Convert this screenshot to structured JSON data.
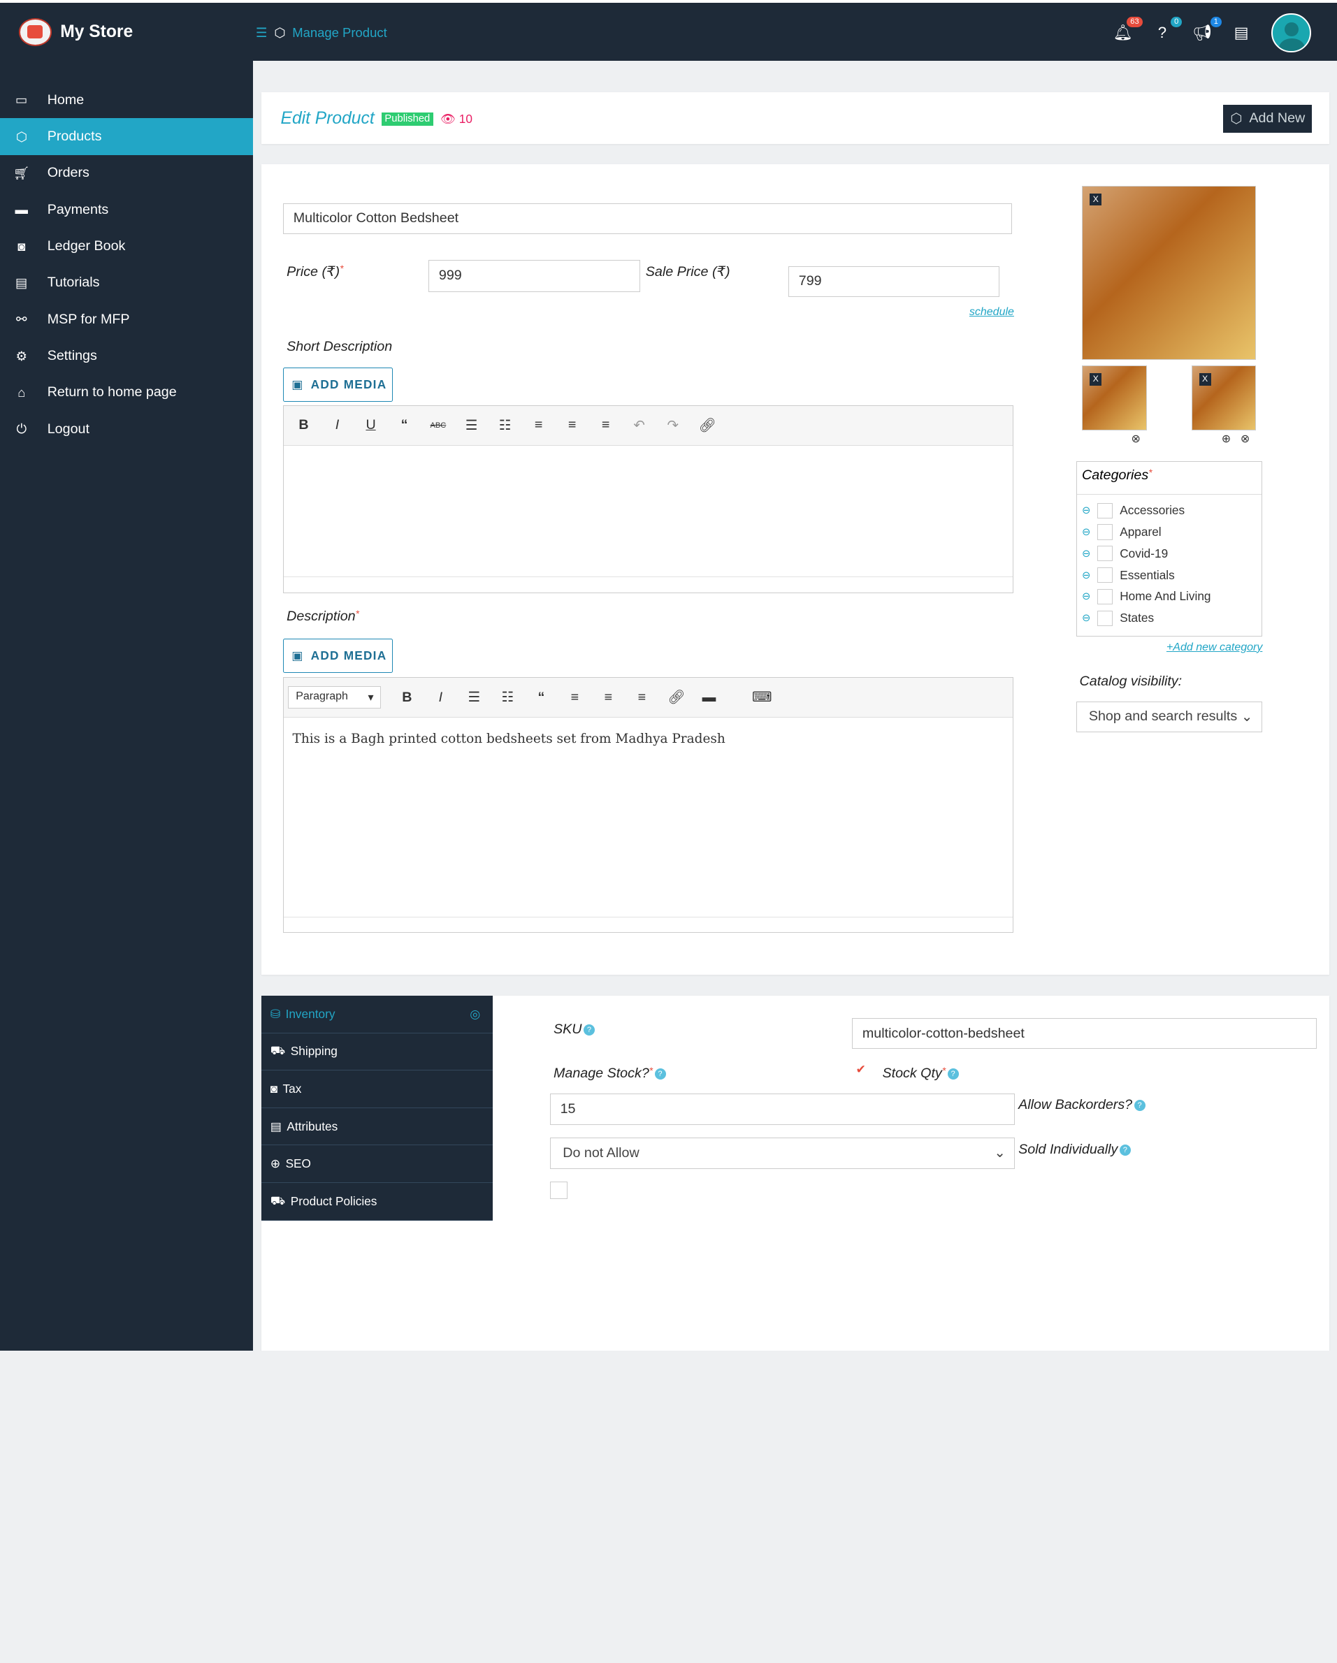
{
  "header": {
    "app_name": "My Store",
    "breadcrumb": "Manage Product",
    "notifications": {
      "bell": "63",
      "help": "0",
      "announce": "1"
    },
    "colors": {
      "primary": "#1e2a38",
      "accent": "#22a6c6",
      "published": "#2ecc71"
    }
  },
  "sidebar": {
    "items": [
      {
        "label": "Home",
        "icon": "monitor-icon"
      },
      {
        "label": "Products",
        "icon": "box-icon"
      },
      {
        "label": "Orders",
        "icon": "cart-icon"
      },
      {
        "label": "Payments",
        "icon": "card-icon"
      },
      {
        "label": "Ledger Book",
        "icon": "money-icon"
      },
      {
        "label": "Tutorials",
        "icon": "book-icon"
      },
      {
        "label": "MSP for MFP",
        "icon": "handshake-icon"
      },
      {
        "label": "Settings",
        "icon": "gears-icon"
      },
      {
        "label": "Return to home page",
        "icon": "home-icon"
      },
      {
        "label": "Logout",
        "icon": "power-icon"
      }
    ],
    "active_index": 1
  },
  "page": {
    "title": "Edit Product",
    "status": "Published",
    "views": "10",
    "add_new": "Add New"
  },
  "product": {
    "name": "Multicolor Cotton Bedsheet",
    "price_label": "Price (₹)",
    "price": "999",
    "sale_label": "Sale Price (₹)",
    "sale_price": "799",
    "schedule": "schedule",
    "short_desc_label": "Short Description",
    "add_media": "ADD MEDIA",
    "desc_label": "Description",
    "paragraph": "Paragraph",
    "description": "This is a Bagh printed cotton bedsheets set from Madhya Pradesh"
  },
  "categories": {
    "title": "Categories",
    "items": [
      "Accessories",
      "Apparel",
      "Covid-19",
      "Essentials",
      "Home And Living",
      "States"
    ],
    "add_link": "+Add new category"
  },
  "visibility": {
    "label": "Catalog visibility:",
    "value": "Shop and search results"
  },
  "tabs": [
    {
      "label": "Inventory",
      "icon": "database-icon"
    },
    {
      "label": "Shipping",
      "icon": "truck-icon"
    },
    {
      "label": "Tax",
      "icon": "money-icon"
    },
    {
      "label": "Attributes",
      "icon": "list-icon"
    },
    {
      "label": "SEO",
      "icon": "globe-icon"
    },
    {
      "label": "Product Policies",
      "icon": "policy-icon"
    }
  ],
  "inventory": {
    "sku_label": "SKU",
    "sku": "multicolor-cotton-bedsheet",
    "manage_stock_label": "Manage Stock?",
    "stock_qty_label": "Stock Qty",
    "stock_qty": "15",
    "backorders_label": "Allow Backorders?",
    "backorders": "Do not Allow",
    "sold_individually_label": "Sold Individually"
  }
}
